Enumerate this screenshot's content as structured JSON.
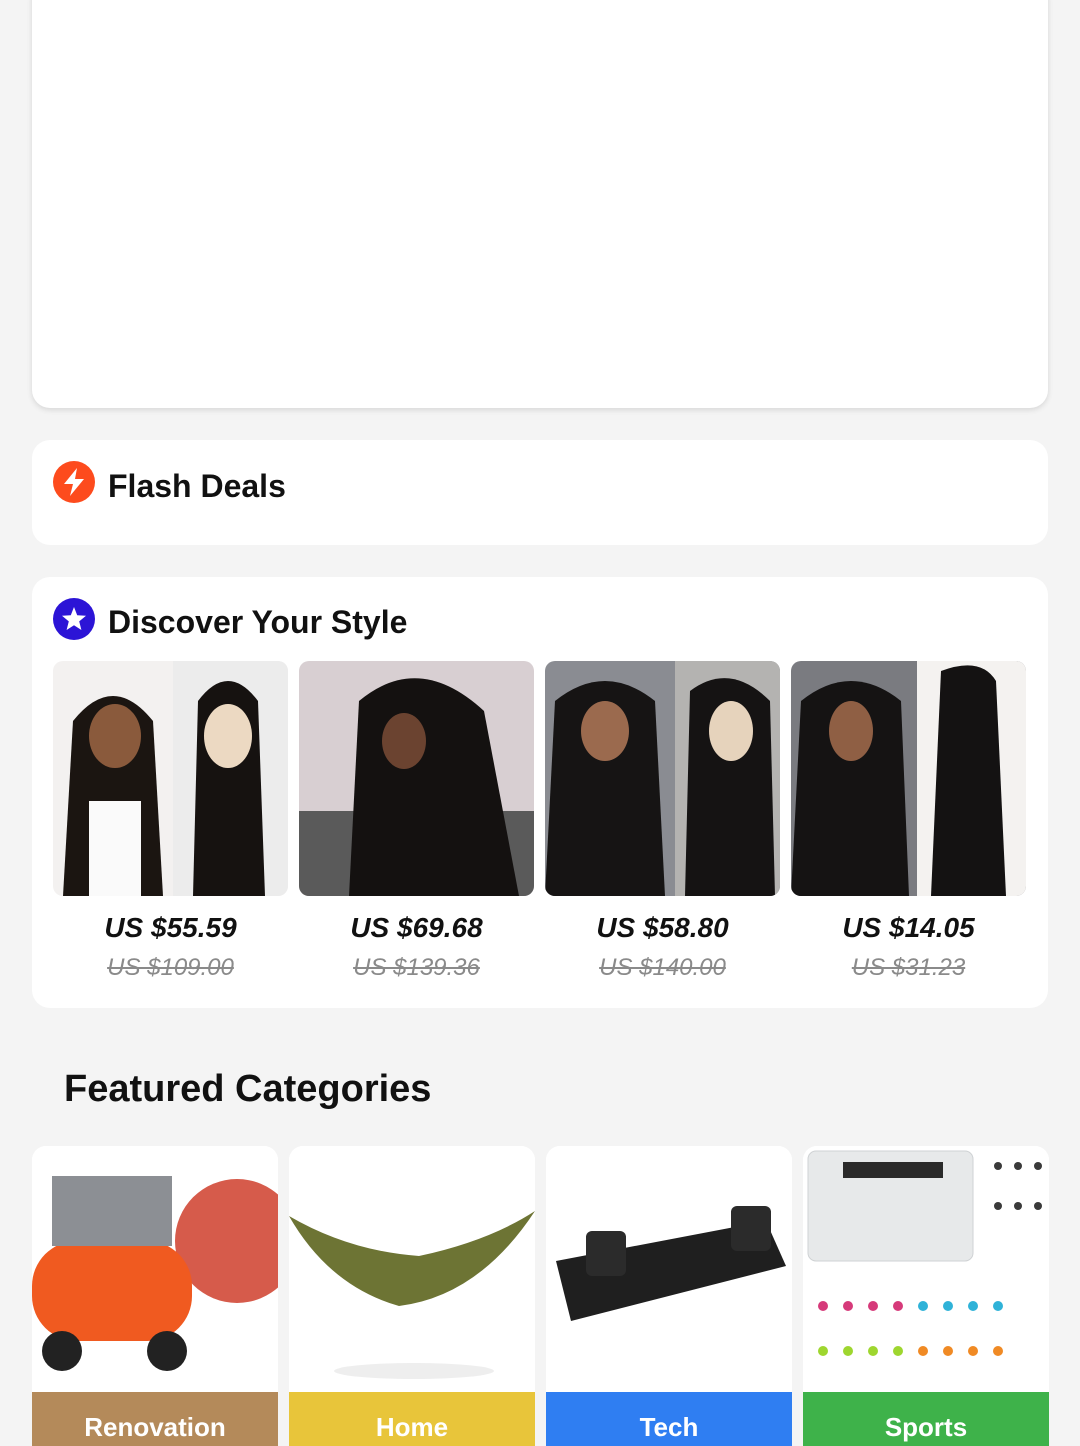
{
  "flash_deals": {
    "title": "Flash Deals",
    "icon": "lightning-icon",
    "color": "#fd4b1d"
  },
  "discover": {
    "title": "Discover Your Style",
    "icon": "star-icon",
    "color": "#2c14d6",
    "products": [
      {
        "price": "US $55.59",
        "old_price": "US $109.00"
      },
      {
        "price": "US $69.68",
        "old_price": "US $139.36"
      },
      {
        "price": "US $58.80",
        "old_price": "US $140.00"
      },
      {
        "price": "US $14.05",
        "old_price": "US $31.23"
      }
    ]
  },
  "featured": {
    "title": "Featured Categories",
    "categories": [
      {
        "label": "Renovation",
        "color": "#b48a5a"
      },
      {
        "label": "Home",
        "color": "#e8c53a"
      },
      {
        "label": "Tech",
        "color": "#2f7ef2"
      },
      {
        "label": "Sports",
        "color": "#3eb24a"
      }
    ]
  }
}
